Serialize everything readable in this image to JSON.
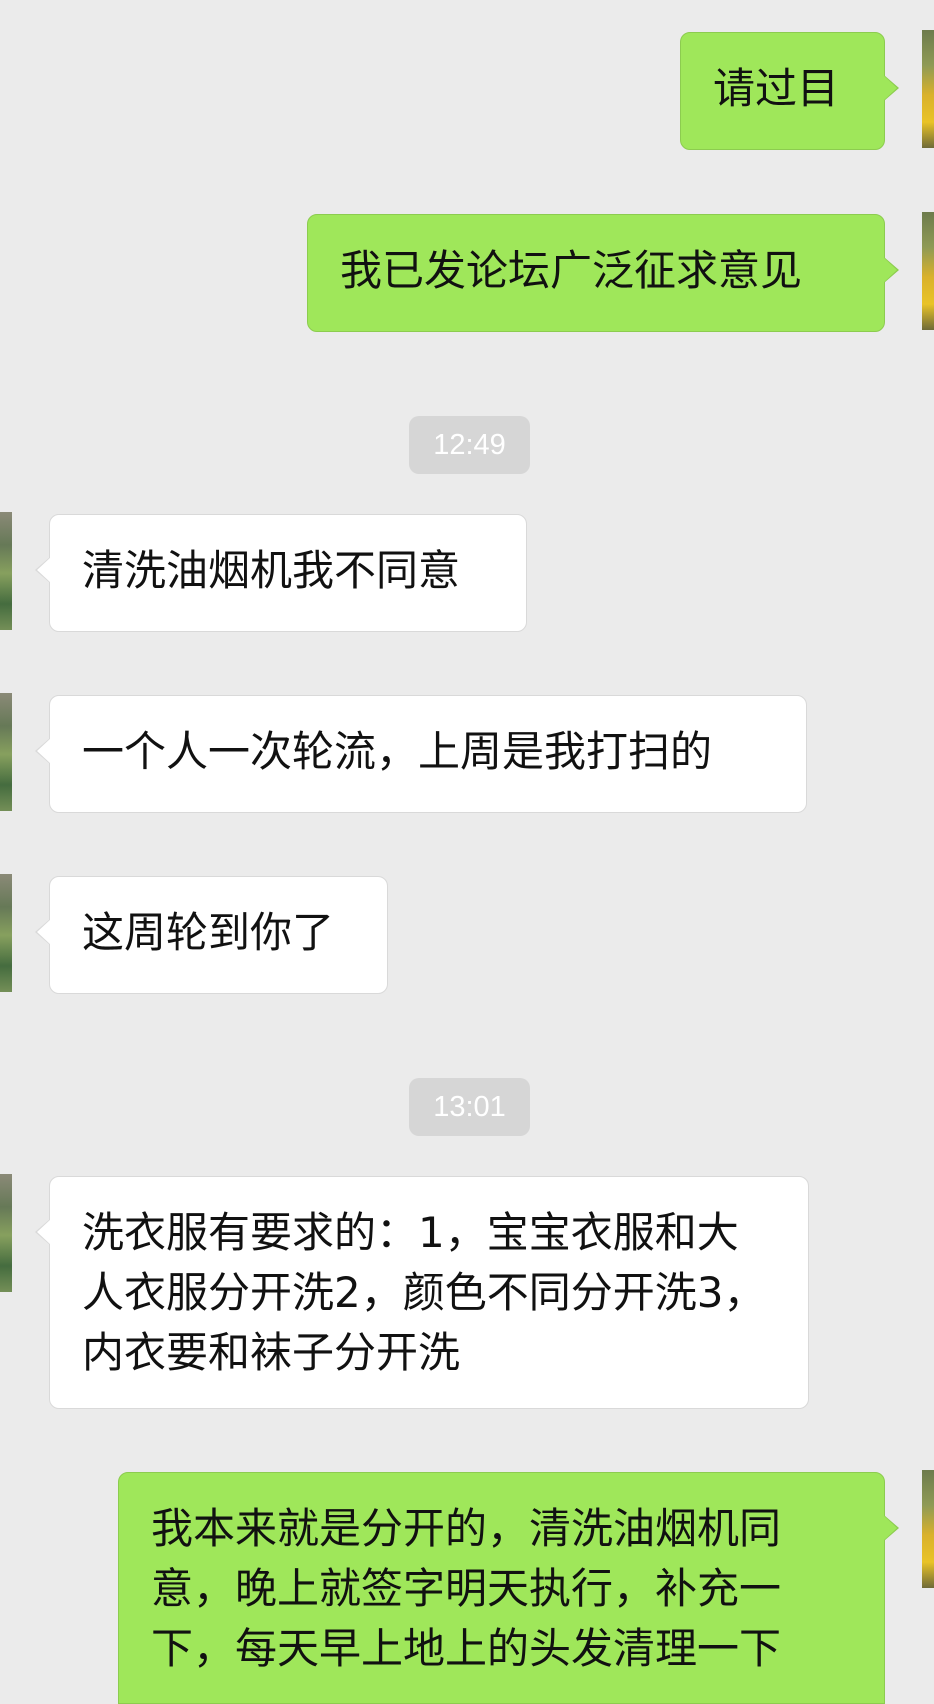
{
  "conversation": {
    "messages": [
      {
        "side": "out",
        "text": "请过目"
      },
      {
        "side": "out",
        "text": "我已发论坛广泛征求意见"
      },
      {
        "type": "time",
        "text": "12:49"
      },
      {
        "side": "in",
        "text": "清洗油烟机我不同意"
      },
      {
        "side": "in",
        "text": "一个人一次轮流，上周是我打扫的"
      },
      {
        "side": "in",
        "text": "这周轮到你了"
      },
      {
        "type": "time",
        "text": "13:01"
      },
      {
        "side": "in",
        "text": "洗衣服有要求的：1，宝宝衣服和大人衣服分开洗2，颜色不同分开洗3，内衣要和袜子分开洗"
      },
      {
        "side": "out",
        "text": "我本来就是分开的，清洗油烟机同意，晚上就签字明天执行，补充一下，每天早上地上的头发清理一下"
      }
    ]
  },
  "colors": {
    "background": "#ebebeb",
    "outgoing_bubble": "#9fe75a",
    "incoming_bubble": "#ffffff",
    "timestamp_bubble": "#d6d6d6"
  },
  "icons": {
    "avatar": "user-avatar"
  }
}
